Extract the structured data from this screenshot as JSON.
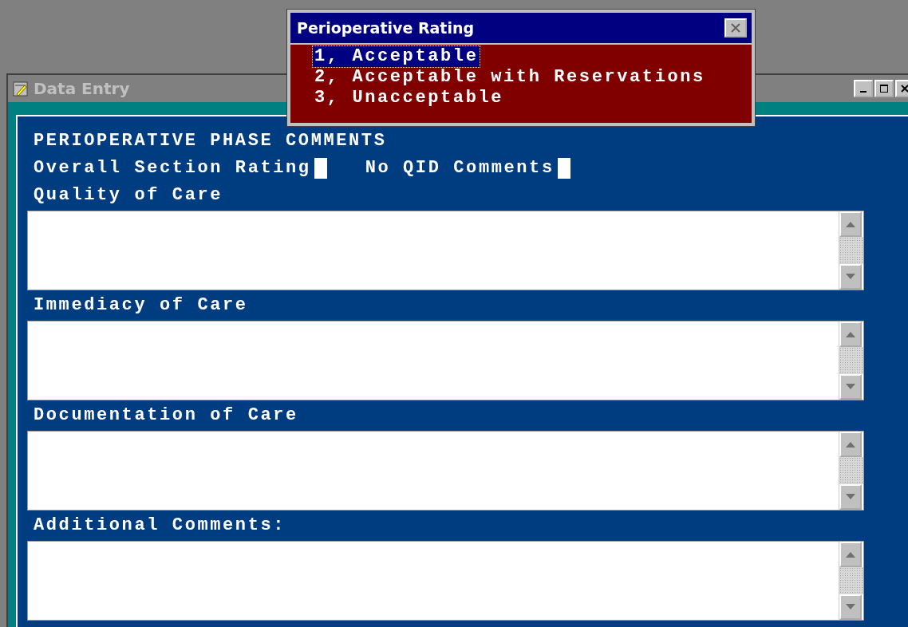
{
  "popup": {
    "title": "Perioperative Rating",
    "options": [
      {
        "label": "1, Acceptable",
        "selected": true
      },
      {
        "label": "2, Acceptable with Reservations",
        "selected": false
      },
      {
        "label": "3, Unacceptable",
        "selected": false
      }
    ]
  },
  "window": {
    "title": "Data Entry"
  },
  "form": {
    "heading": "PERIOPERATIVE PHASE COMMENTS",
    "fields": [
      {
        "label": "Overall Section Rating"
      },
      {
        "label": "No QID Comments"
      }
    ],
    "sections": [
      {
        "label": "Quality of Care"
      },
      {
        "label": "Immediacy of Care"
      },
      {
        "label": "Documentation of Care"
      },
      {
        "label": "Additional Comments:"
      }
    ]
  }
}
